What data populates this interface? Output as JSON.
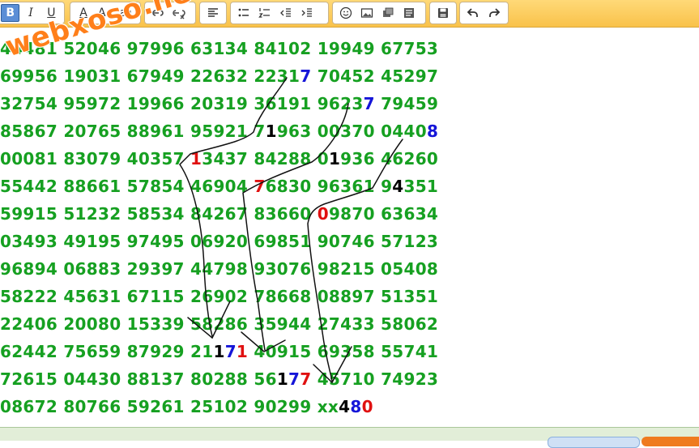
{
  "toolbar": {
    "bold": "B",
    "italic": "I",
    "underline": "U",
    "font_color": "A",
    "font_size": "A",
    "font_size_sup": "±",
    "format": "a",
    "format_sub": "g"
  },
  "watermark": "webxoso.net",
  "rows": [
    [
      {
        "t": "44481 52046 97996 63134 84102 19949 67753"
      }
    ],
    [
      {
        "t": "69956 19031 67949 22632 2231"
      },
      {
        "t": "7",
        "c": "blu"
      },
      {
        "t": " 70452 45297"
      }
    ],
    [
      {
        "t": "32754 95972 19966 20319 36191 9623"
      },
      {
        "t": "7",
        "c": "blu"
      },
      {
        "t": " 79459"
      }
    ],
    [
      {
        "t": "85867 20765 88961 95921 7"
      },
      {
        "t": "1",
        "c": "blk"
      },
      {
        "t": "963 00370 0440"
      },
      {
        "t": "8",
        "c": "blu"
      }
    ],
    [
      {
        "t": "00081 83079 40357 "
      },
      {
        "t": "1",
        "c": "red"
      },
      {
        "t": "3437 84288 0"
      },
      {
        "t": "1",
        "c": "blk"
      },
      {
        "t": "936 46260"
      }
    ],
    [
      {
        "t": "55442 88661 57854 46904 "
      },
      {
        "t": "7",
        "c": "red"
      },
      {
        "t": "6830 96361 9"
      },
      {
        "t": "4",
        "c": "blk"
      },
      {
        "t": "351"
      }
    ],
    [
      {
        "t": "59915 51232 58534 84267 83660 "
      },
      {
        "t": "0",
        "c": "red"
      },
      {
        "t": "9870 63634"
      }
    ],
    [
      {
        "t": "03493 49195 97495 06920 69851 90746 57123"
      }
    ],
    [
      {
        "t": "96894 06883 29397 44798 93076 98215 05408"
      }
    ],
    [
      {
        "t": "58222 45631 67115 26902 78668 08897 51351"
      }
    ],
    [
      {
        "t": "22406 20080 15339 58286 35944 27433 58062"
      }
    ],
    [
      {
        "t": "62442 75659 87929 21"
      },
      {
        "t": "1",
        "c": "blk"
      },
      {
        "t": "7",
        "c": "blu"
      },
      {
        "t": "1",
        "c": "red"
      },
      {
        "t": " 40915 69358 55741"
      }
    ],
    [
      {
        "t": "72615 04430 88137 80288 56"
      },
      {
        "t": "1",
        "c": "blk"
      },
      {
        "t": "7",
        "c": "blu"
      },
      {
        "t": "7",
        "c": "red"
      },
      {
        "t": " 45710 74923"
      }
    ],
    [
      {
        "t": "08672 80766 59261 25102 90299 xx"
      },
      {
        "t": "4",
        "c": "blk"
      },
      {
        "t": "8",
        "c": "blu"
      },
      {
        "t": "0",
        "c": "red"
      }
    ]
  ],
  "colors": {
    "digits": "#16a021",
    "black": "#000000",
    "blue": "#1515d8",
    "red": "#e01010",
    "toolbar": "#f9c24a",
    "watermark": "#ff7f1a"
  }
}
